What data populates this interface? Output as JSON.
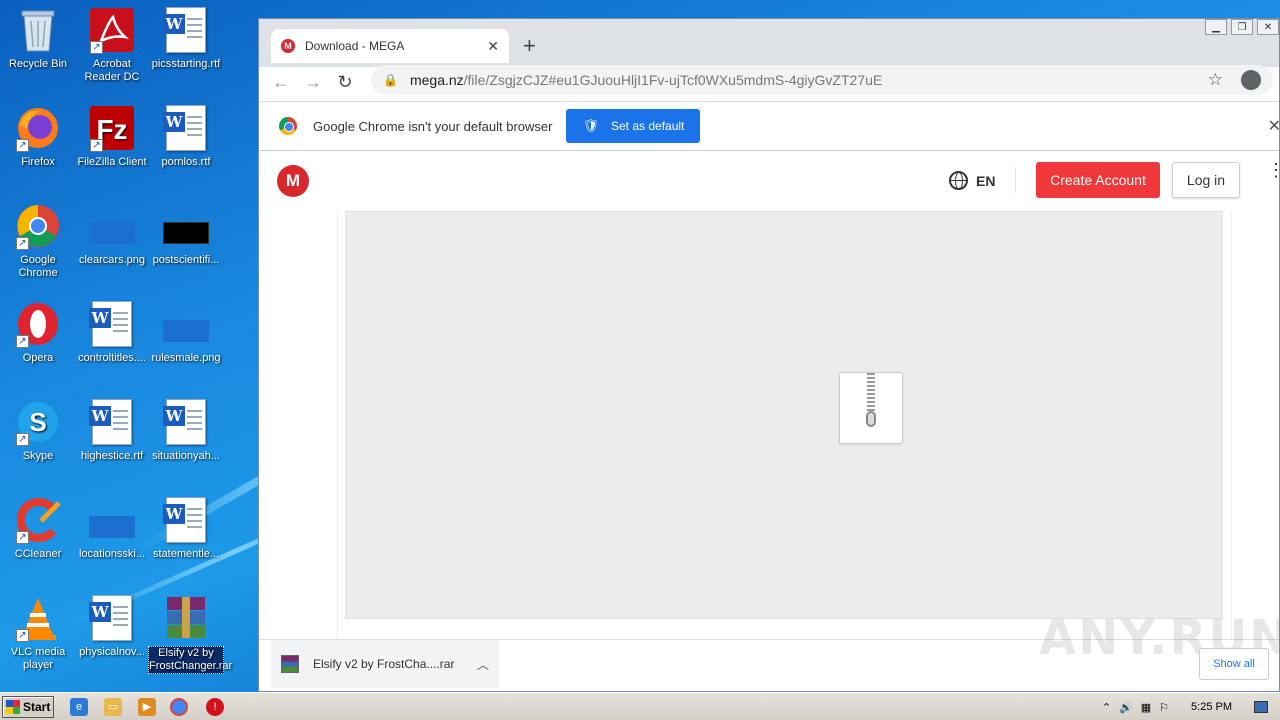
{
  "desktop": {
    "icons": [
      {
        "label": "Recycle Bin",
        "icon": "recycle-bin-icon"
      },
      {
        "label": "Acrobat Reader DC",
        "icon": "acrobat-icon"
      },
      {
        "label": "picsstarting.rtf",
        "icon": "word-doc-icon"
      },
      {
        "label": "Firefox",
        "icon": "firefox-icon"
      },
      {
        "label": "FileZilla Client",
        "icon": "filezilla-icon"
      },
      {
        "label": "pornlos.rtf",
        "icon": "word-doc-icon"
      },
      {
        "label": "Google Chrome",
        "icon": "chrome-icon"
      },
      {
        "label": "clearcars.png",
        "icon": "png-icon"
      },
      {
        "label": "postscientifi...",
        "icon": "png-icon"
      },
      {
        "label": "Opera",
        "icon": "opera-icon"
      },
      {
        "label": "controltitles....",
        "icon": "word-doc-icon"
      },
      {
        "label": "rulesmale.png",
        "icon": "png-icon"
      },
      {
        "label": "Skype",
        "icon": "skype-icon"
      },
      {
        "label": "highestice.rtf",
        "icon": "word-doc-icon"
      },
      {
        "label": "situationyah...",
        "icon": "word-doc-icon"
      },
      {
        "label": "CCleaner",
        "icon": "ccleaner-icon"
      },
      {
        "label": "locationsski...",
        "icon": "png-icon"
      },
      {
        "label": "statementle...",
        "icon": "word-doc-icon"
      },
      {
        "label": "VLC media player",
        "icon": "vlc-icon"
      },
      {
        "label": "physicalnov...",
        "icon": "word-doc-icon"
      },
      {
        "label": "Elsify v2 by FrostChanger.rar",
        "icon": "rar-icon"
      }
    ]
  },
  "browser": {
    "tab_title": "Download - MEGA",
    "tab_favicon": "M",
    "new_tab": "+",
    "url_host": "mega.nz",
    "url_path": "/file/ZsgjzCJZ#eu1GJuouHljI1Fv-ujTcf0WXu5mdmS-4giyGvZT27uE",
    "infobar_text": "Google Chrome isn't your default browser",
    "infobar_button": "Set as default",
    "accent": "#1a73e8"
  },
  "page": {
    "logo": "M",
    "language": "EN",
    "create_account": "Create Account",
    "login": "Log in",
    "brand_color": "#f0373a"
  },
  "downloads": {
    "item_name": "Elsify v2 by FrostCha....rar",
    "show_all": "Show all",
    "watermark": "ANY.RUN"
  },
  "taskbar": {
    "start_label": "Start",
    "clock": "5:25 PM"
  }
}
